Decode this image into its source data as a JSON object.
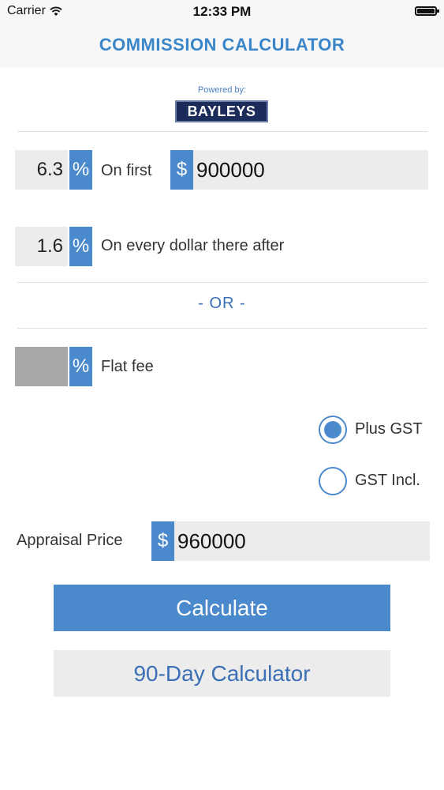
{
  "status_bar": {
    "carrier": "Carrier",
    "time": "12:33 PM"
  },
  "nav": {
    "title": "COMMISSION CALCULATOR"
  },
  "branding": {
    "powered_by": "Powered by:",
    "logo_text": "BAYLEYS"
  },
  "tiers": {
    "first": {
      "rate": "6.3",
      "percent_symbol": "%",
      "label": "On first",
      "currency_symbol": "$",
      "amount": "900000"
    },
    "second": {
      "rate": "1.6",
      "percent_symbol": "%",
      "label": "On every dollar there after"
    }
  },
  "or_separator": "- OR -",
  "flat_fee": {
    "rate": "",
    "percent_symbol": "%",
    "label": "Flat fee"
  },
  "gst": {
    "plus": {
      "label": "Plus GST",
      "selected": true
    },
    "incl": {
      "label": "GST Incl.",
      "selected": false
    }
  },
  "appraisal": {
    "label": "Appraisal Price",
    "currency_symbol": "$",
    "amount": "960000"
  },
  "buttons": {
    "calculate": "Calculate",
    "ninety_day": "90-Day Calculator"
  },
  "colors": {
    "accent": "#4a89cb",
    "title": "#3a86c8",
    "field_bg": "#ececec",
    "empty_field_bg": "#a8a8a8",
    "logo_bg": "#1c2c5a"
  },
  "icons": {
    "wifi": "wifi-icon",
    "battery": "battery-icon"
  }
}
